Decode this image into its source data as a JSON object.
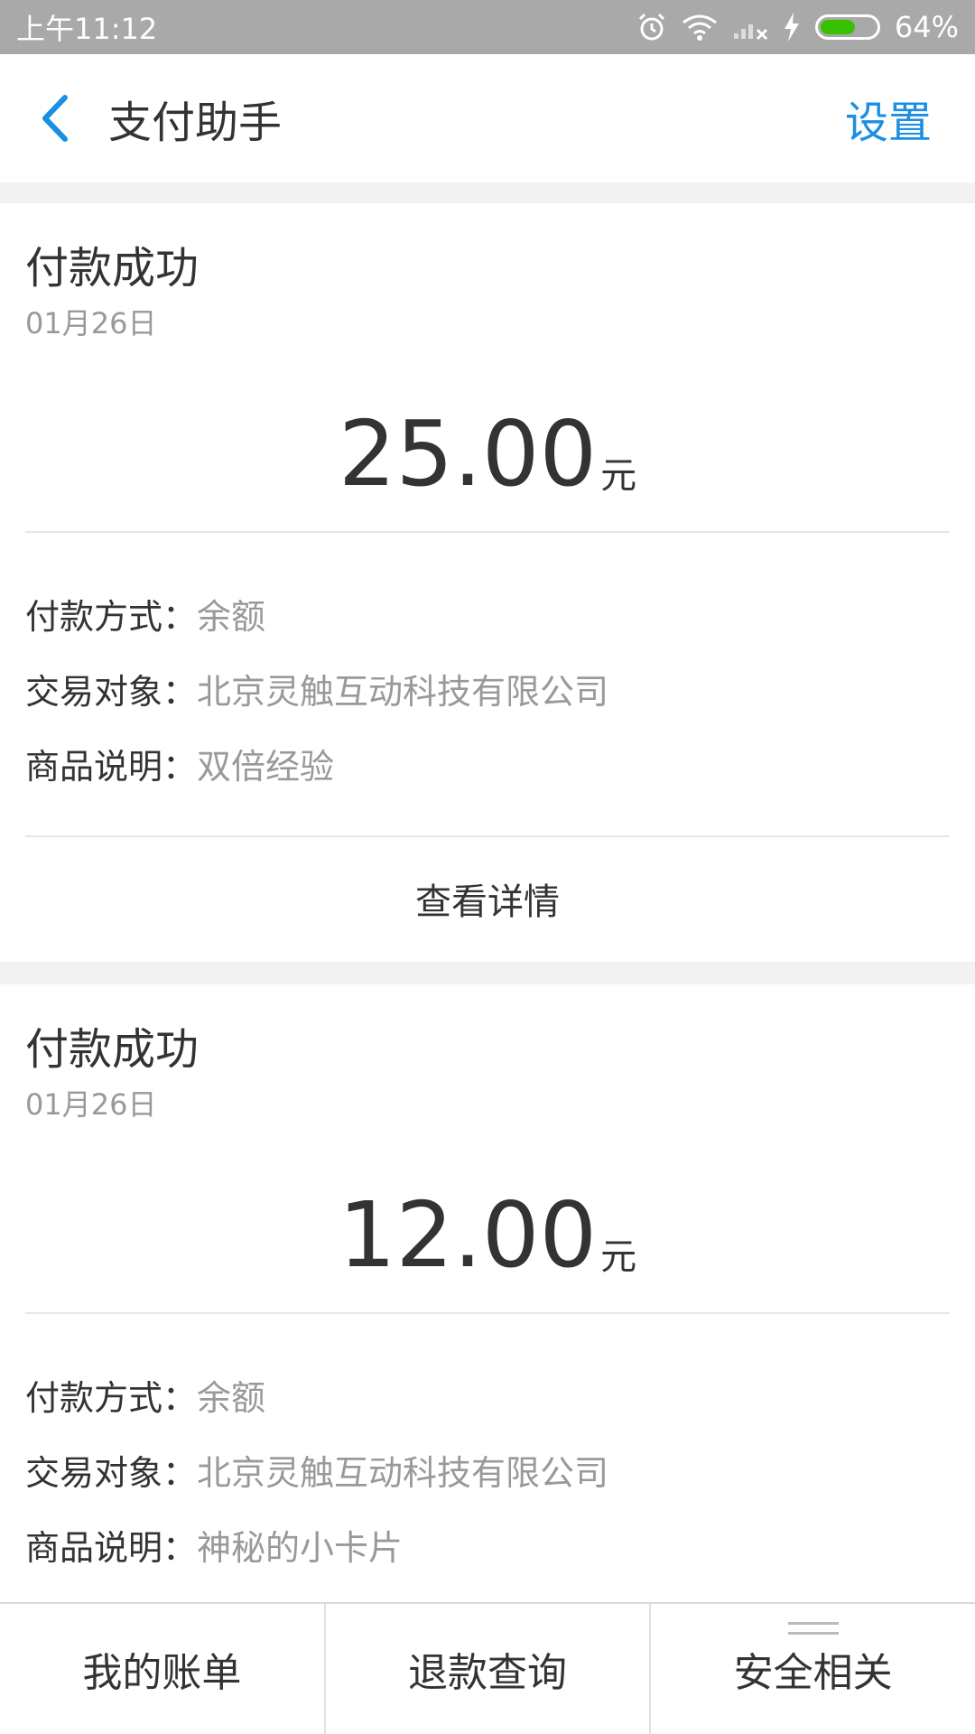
{
  "status_bar": {
    "time": "上午11:12",
    "battery": "64%",
    "battery_level": 0.64,
    "icons": [
      "alarm-icon",
      "wifi-icon",
      "signal-icon",
      "charging-icon",
      "battery-icon"
    ]
  },
  "nav": {
    "title": "支付助手",
    "settings_label": "设置",
    "back_icon": "chevron-left-icon"
  },
  "colors": {
    "accent": "#1a8fe3",
    "battery_fill": "#39c000"
  },
  "cards": [
    {
      "status": "付款成功",
      "date": "01月26日",
      "amount": "25.00",
      "unit": "元",
      "fields": [
        {
          "label": "付款方式：",
          "value": "余额"
        },
        {
          "label": "交易对象：",
          "value": "北京灵触互动科技有限公司"
        },
        {
          "label": "商品说明：",
          "value": "双倍经验"
        }
      ],
      "detail_label": "查看详情"
    },
    {
      "status": "付款成功",
      "date": "01月26日",
      "amount": "12.00",
      "unit": "元",
      "fields": [
        {
          "label": "付款方式：",
          "value": "余额"
        },
        {
          "label": "交易对象：",
          "value": "北京灵触互动科技有限公司"
        },
        {
          "label": "商品说明：",
          "value": "神秘的小卡片"
        }
      ]
    }
  ],
  "tabs": [
    {
      "label": "我的账单"
    },
    {
      "label": "退款查询"
    },
    {
      "label": "安全相关",
      "icon": "menu-icon"
    }
  ]
}
